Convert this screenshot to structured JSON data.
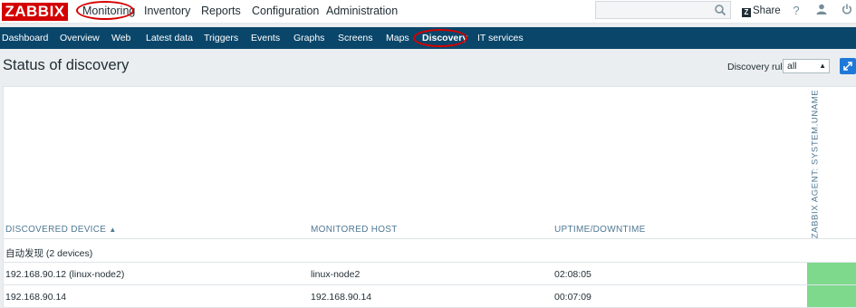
{
  "brand": "ZABBIX",
  "top_nav": [
    "Monitoring",
    "Inventory",
    "Reports",
    "Configuration",
    "Administration"
  ],
  "search": {
    "placeholder": ""
  },
  "share_label": "Share",
  "help_label": "?",
  "sub_nav": [
    "Dashboard",
    "Overview",
    "Web",
    "Latest data",
    "Triggers",
    "Events",
    "Graphs",
    "Screens",
    "Maps",
    "Discovery",
    "IT services"
  ],
  "page": {
    "title": "Status of discovery"
  },
  "filter": {
    "label": "Discovery rule",
    "value": "all"
  },
  "table": {
    "headers": [
      "DISCOVERED DEVICE",
      "MONITORED HOST",
      "UPTIME/DOWNTIME"
    ],
    "sort_indicator": "▲",
    "vertical_header": "ZABBIX AGENT: SYSTEM.UNAME",
    "group": "自动发现 (2 devices)",
    "rows": [
      {
        "device": "192.168.90.12 (linux-node2)",
        "host": "linux-node2",
        "uptime": "02:08:05"
      },
      {
        "device": "192.168.90.14",
        "host": "192.168.90.14",
        "uptime": "00:07:09"
      }
    ]
  },
  "colors": {
    "brand": "#d40000",
    "nav_bg": "#0a466a",
    "status_up": "#7ed98c",
    "header_text": "#4f7892"
  }
}
